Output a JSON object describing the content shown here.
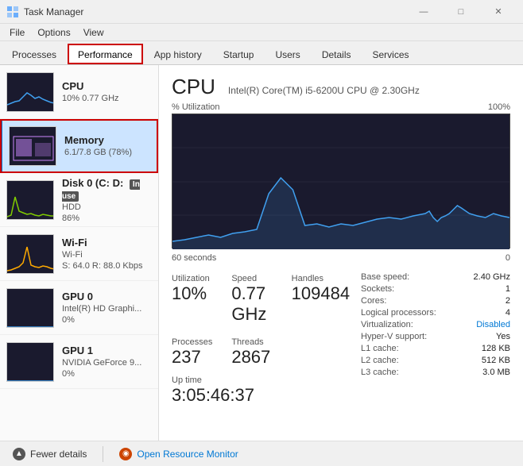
{
  "window": {
    "title": "Task Manager",
    "controls": {
      "minimize": "—",
      "maximize": "□",
      "close": "✕"
    }
  },
  "menubar": {
    "items": [
      "File",
      "Options",
      "View"
    ]
  },
  "tabs": [
    {
      "id": "processes",
      "label": "Processes"
    },
    {
      "id": "performance",
      "label": "Performance",
      "active": true,
      "highlighted": true
    },
    {
      "id": "apphistory",
      "label": "App history"
    },
    {
      "id": "startup",
      "label": "Startup"
    },
    {
      "id": "users",
      "label": "Users"
    },
    {
      "id": "details",
      "label": "Details"
    },
    {
      "id": "services",
      "label": "Services"
    }
  ],
  "sidebar": {
    "items": [
      {
        "id": "cpu",
        "name": "CPU",
        "detail": "10%  0.77 GHz",
        "graph_type": "cpu"
      },
      {
        "id": "memory",
        "name": "Memory",
        "detail": "6.1/7.8 GB (78%)",
        "graph_type": "memory",
        "active": true,
        "highlighted": true
      },
      {
        "id": "disk0",
        "name": "Disk 0 (C: D:",
        "badge": "In use",
        "detail": "HDD\n86%",
        "detail2": "HDD",
        "detail3": "86%",
        "graph_type": "disk"
      },
      {
        "id": "wifi",
        "name": "Wi-Fi",
        "detail": "Wi-Fi",
        "detail2": "S: 64.0  R: 88.0 Kbps",
        "graph_type": "wifi"
      },
      {
        "id": "gpu0",
        "name": "GPU 0",
        "detail": "Intel(R) HD Graphi...",
        "detail2": "0%",
        "graph_type": "gpu0"
      },
      {
        "id": "gpu1",
        "name": "GPU 1",
        "detail": "NVIDIA GeForce 9...",
        "detail2": "0%",
        "graph_type": "gpu1"
      }
    ]
  },
  "panel": {
    "title": "CPU",
    "subtitle": "Intel(R) Core(TM) i5-6200U CPU @ 2.30GHz",
    "util_label": "% Utilization",
    "util_max": "100%",
    "chart_time_label": "60 seconds",
    "chart_time_right": "0",
    "stats": {
      "utilization_label": "Utilization",
      "utilization_value": "10%",
      "speed_label": "Speed",
      "speed_value": "0.77 GHz",
      "handles_label": "Handles",
      "handles_value": "109484",
      "processes_label": "Processes",
      "processes_value": "237",
      "threads_label": "Threads",
      "threads_value": "2867"
    },
    "uptime_label": "Up time",
    "uptime_value": "3:05:46:37",
    "info": [
      {
        "label": "Base speed:",
        "value": "2.40 GHz"
      },
      {
        "label": "Sockets:",
        "value": "1"
      },
      {
        "label": "Cores:",
        "value": "2"
      },
      {
        "label": "Logical processors:",
        "value": "4"
      },
      {
        "label": "Virtualization:",
        "value": "Disabled",
        "special": true
      },
      {
        "label": "Hyper-V support:",
        "value": "Yes"
      },
      {
        "label": "L1 cache:",
        "value": "128 KB"
      },
      {
        "label": "L2 cache:",
        "value": "512 KB"
      },
      {
        "label": "L3 cache:",
        "value": "3.0 MB"
      }
    ]
  },
  "bottombar": {
    "fewer_details_label": "Fewer details",
    "open_monitor_label": "Open Resource Monitor"
  },
  "colors": {
    "accent_blue": "#0078d4",
    "chart_bg": "#1a1a2e",
    "chart_line_cpu": "#40a0f0",
    "chart_line_mem": "#cc88ff",
    "highlight_red": "#cc0000"
  }
}
